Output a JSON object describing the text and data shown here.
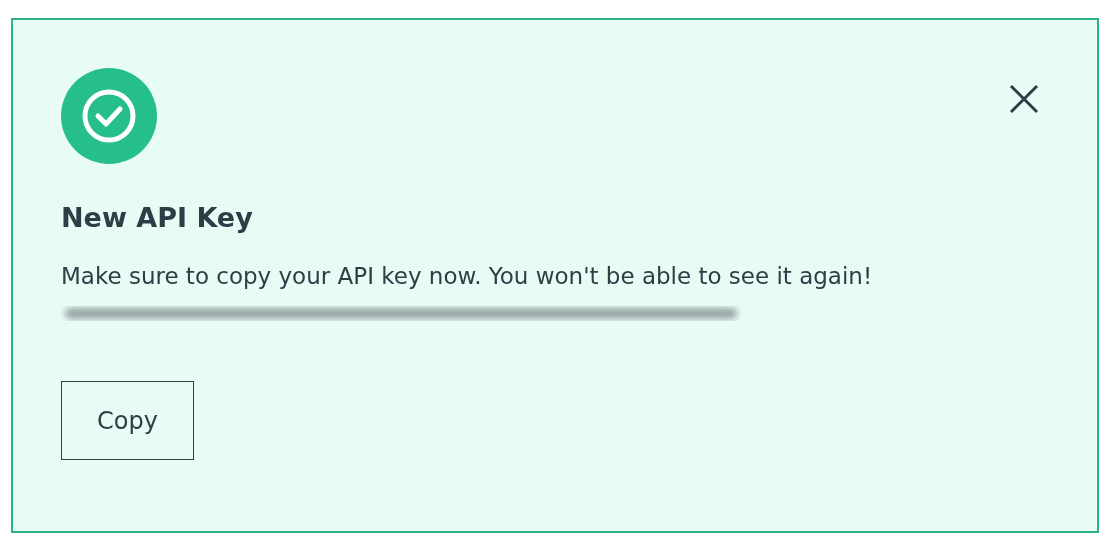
{
  "alert": {
    "title": "New API Key",
    "message": "Make sure to copy your API key now. You won't be able to see it again!",
    "buttons": [
      "Copy"
    ]
  }
}
